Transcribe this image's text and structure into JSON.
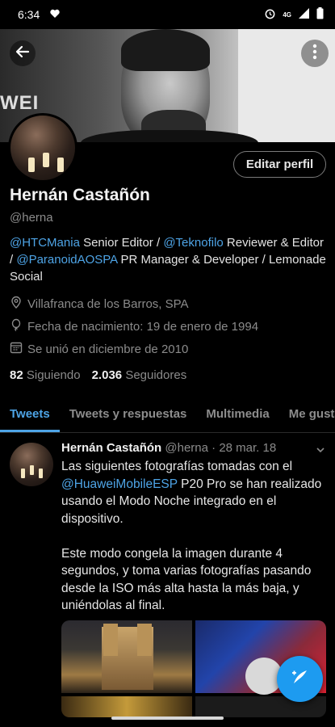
{
  "status_bar": {
    "time": "6:34",
    "icons": [
      "heart-shield-icon",
      "alarm-icon",
      "data-4g-icon",
      "signal-icon",
      "battery-icon"
    ],
    "network_label": "4G"
  },
  "header": {
    "back_icon": "arrow-left-icon",
    "more_icon": "more-vertical-icon",
    "banner_text": "WEI"
  },
  "profile": {
    "edit_label": "Editar perfil",
    "name": "Hernán Castañón",
    "handle": "@herna",
    "bio": [
      {
        "text": "@HTCMania",
        "link": true
      },
      {
        "text": " Senior Editor / ",
        "link": false
      },
      {
        "text": "@Teknofilo",
        "link": true
      },
      {
        "text": " Reviewer & Editor / ",
        "link": false
      },
      {
        "text": "@ParanoidAOSPA",
        "link": true
      },
      {
        "text": " PR Manager & Developer / Lemonade Social",
        "link": false
      }
    ],
    "location": "Villafranca de los Barros, SPA",
    "birthday": "Fecha de nacimiento: 19 de enero de 1994",
    "joined": "Se unió en diciembre de 2010",
    "following_count": "82",
    "following_label": "Siguiendo",
    "followers_count": "2.036",
    "followers_label": "Seguidores"
  },
  "tabs": [
    {
      "label": "Tweets",
      "active": true
    },
    {
      "label": "Tweets y respuestas",
      "active": false
    },
    {
      "label": "Multimedia",
      "active": false
    },
    {
      "label": "Me gusta",
      "active": false
    }
  ],
  "tweet": {
    "name": "Hernán Castañón",
    "handle": "@herna",
    "separator": "·",
    "date": "28 mar. 18",
    "para1_pre": "Las siguientes fotografías tomadas con el ",
    "para1_link": "@HuaweiMobileESP",
    "para1_post": " P20 Pro se han realizado usando el Modo Noche integrado en el dispositivo.",
    "para2": "Este modo congela la imagen durante 4 segundos, y toma varias fotografías pasando desde la ISO más alta hasta la más baja, y uniéndolas al final.",
    "media_count": 4
  },
  "fab": {
    "icon": "compose-tweet-icon"
  },
  "colors": {
    "accent": "#1d9bf0",
    "link": "#4ea4e6",
    "background": "#000000",
    "muted": "#8b8b8b"
  }
}
